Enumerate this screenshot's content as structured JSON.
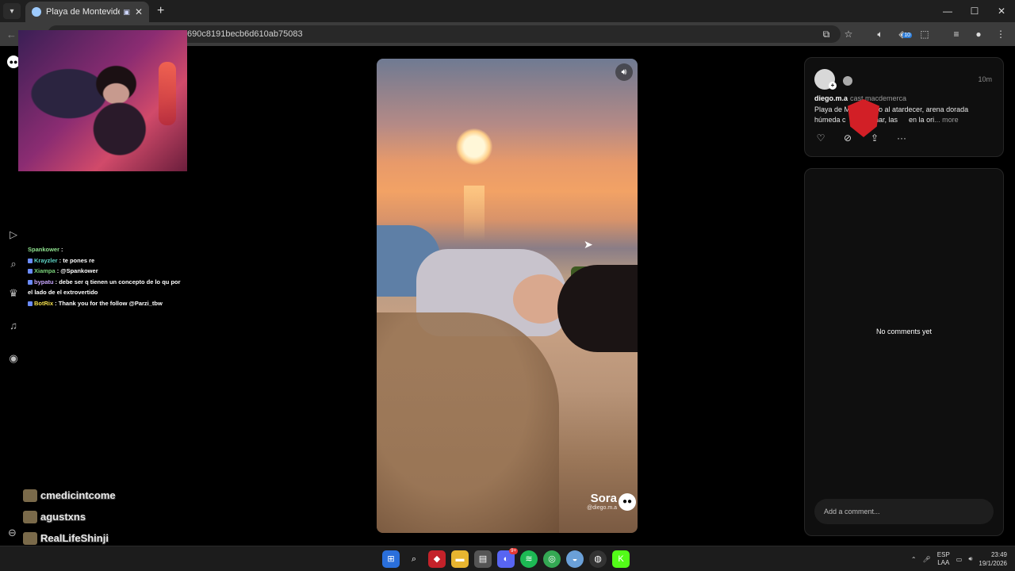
{
  "browser": {
    "tab_title": "Playa de Montevideo al atar",
    "new_tab": "+",
    "url": "690c8191becb6d610ab75083",
    "extension_badge": "10",
    "window": {
      "minimize": "—",
      "maximize": "☐",
      "close": "✕"
    }
  },
  "chat": [
    {
      "user": "Spankower",
      "sep": ":",
      "text": "",
      "color": "#8fe28f"
    },
    {
      "user": "Krayzler",
      "sep": ":",
      "text": "te pones re",
      "color": "#5fd7c8"
    },
    {
      "user": "Xiampa",
      "sep": ":",
      "text": "@Spankower",
      "color": "#7ad27a"
    },
    {
      "user": "bypatu",
      "sep": ":",
      "text": "debe ser q tienen un concepto de lo qu por el lado de el extrovertido",
      "color": "#c9a7ff"
    },
    {
      "user": "BotRix",
      "sep": ":",
      "text": "Thank you for the follow @Parzi_tbw",
      "color": "#f4e04d"
    }
  ],
  "follows": [
    {
      "name": "cmedicintcome"
    },
    {
      "name": "agustxns"
    },
    {
      "name": "RealLifeShinji"
    }
  ],
  "video": {
    "watermark_brand": "Sora",
    "watermark_handle": "@diego.m.a"
  },
  "post": {
    "time": "10m",
    "author": "diego.m.a",
    "cast": "cast macdemerca",
    "description_1": "Playa de M",
    "description_2": "o al atardecer, arena dorada",
    "description_3": "húmeda c",
    "description_4": "mar, las",
    "description_5": "en la ori",
    "more": "... more"
  },
  "comments": {
    "empty_text": "No comments yet",
    "input_placeholder": "Add a comment..."
  },
  "taskbar": {
    "lang_1": "ESP",
    "lang_2": "LAA",
    "time": "23:49",
    "date": "19/1/2026",
    "discord_badge": "9+"
  }
}
